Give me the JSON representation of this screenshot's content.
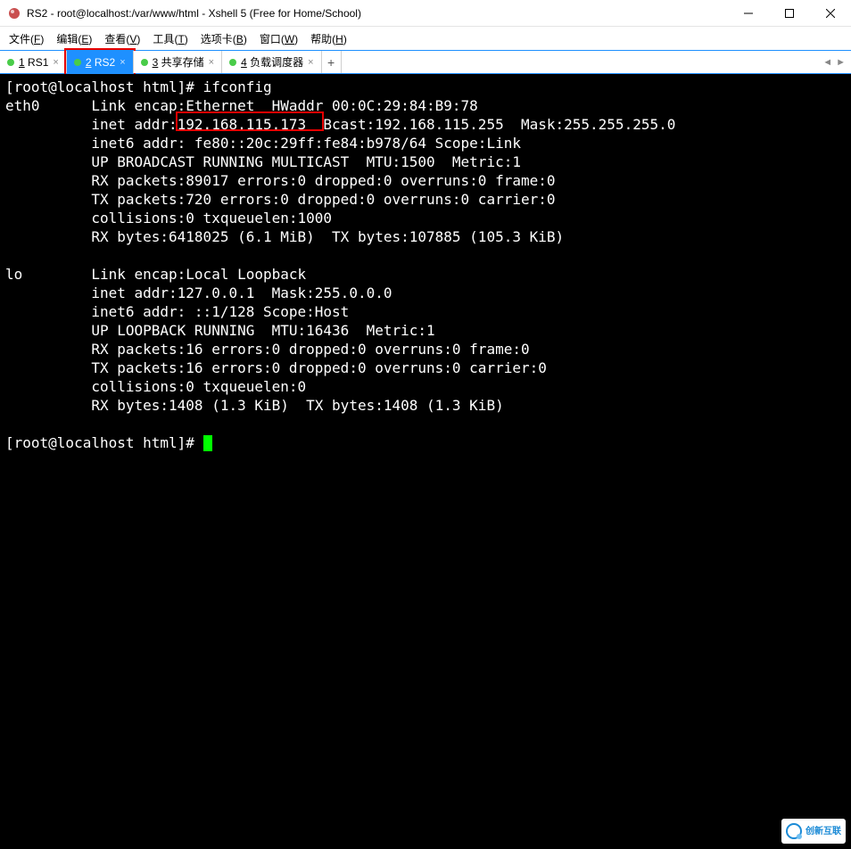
{
  "window": {
    "title": "RS2 - root@localhost:/var/www/html - Xshell 5 (Free for Home/School)"
  },
  "menu": {
    "items": [
      {
        "label": "文件",
        "key": "F"
      },
      {
        "label": "编辑",
        "key": "E"
      },
      {
        "label": "查看",
        "key": "V"
      },
      {
        "label": "工具",
        "key": "T"
      },
      {
        "label": "选项卡",
        "key": "B"
      },
      {
        "label": "窗口",
        "key": "W"
      },
      {
        "label": "帮助",
        "key": "H"
      }
    ]
  },
  "tabs": {
    "items": [
      {
        "num": "1",
        "label": "RS1",
        "active": false
      },
      {
        "num": "2",
        "label": "RS2",
        "active": true,
        "annotated": true
      },
      {
        "num": "3",
        "label": "共享存储",
        "active": false
      },
      {
        "num": "4",
        "label": "负载调度器",
        "active": false
      }
    ],
    "add": "+",
    "nav_left": "◄",
    "nav_right": "►"
  },
  "terminal": {
    "prompt1": "[root@localhost html]# ifconfig",
    "eth0_l1": "eth0      Link encap:Ethernet  HWaddr 00:0C:29:84:B9:78",
    "eth0_l2": "          inet addr:192.168.115.173  Bcast:192.168.115.255  Mask:255.255.255.0",
    "eth0_l3": "          inet6 addr: fe80::20c:29ff:fe84:b978/64 Scope:Link",
    "eth0_l4": "          UP BROADCAST RUNNING MULTICAST  MTU:1500  Metric:1",
    "eth0_l5": "          RX packets:89017 errors:0 dropped:0 overruns:0 frame:0",
    "eth0_l6": "          TX packets:720 errors:0 dropped:0 overruns:0 carrier:0",
    "eth0_l7": "          collisions:0 txqueuelen:1000",
    "eth0_l8": "          RX bytes:6418025 (6.1 MiB)  TX bytes:107885 (105.3 KiB)",
    "blank1": "",
    "lo_l1": "lo        Link encap:Local Loopback",
    "lo_l2": "          inet addr:127.0.0.1  Mask:255.0.0.0",
    "lo_l3": "          inet6 addr: ::1/128 Scope:Host",
    "lo_l4": "          UP LOOPBACK RUNNING  MTU:16436  Metric:1",
    "lo_l5": "          RX packets:16 errors:0 dropped:0 overruns:0 frame:0",
    "lo_l6": "          TX packets:16 errors:0 dropped:0 overruns:0 carrier:0",
    "lo_l7": "          collisions:0 txqueuelen:0",
    "lo_l8": "          RX bytes:1408 (1.3 KiB)  TX bytes:1408 (1.3 KiB)",
    "blank2": "",
    "prompt2": "[root@localhost html]# ",
    "highlight_ip": "192.168.115.173"
  },
  "watermark": {
    "text": "创新互联"
  }
}
